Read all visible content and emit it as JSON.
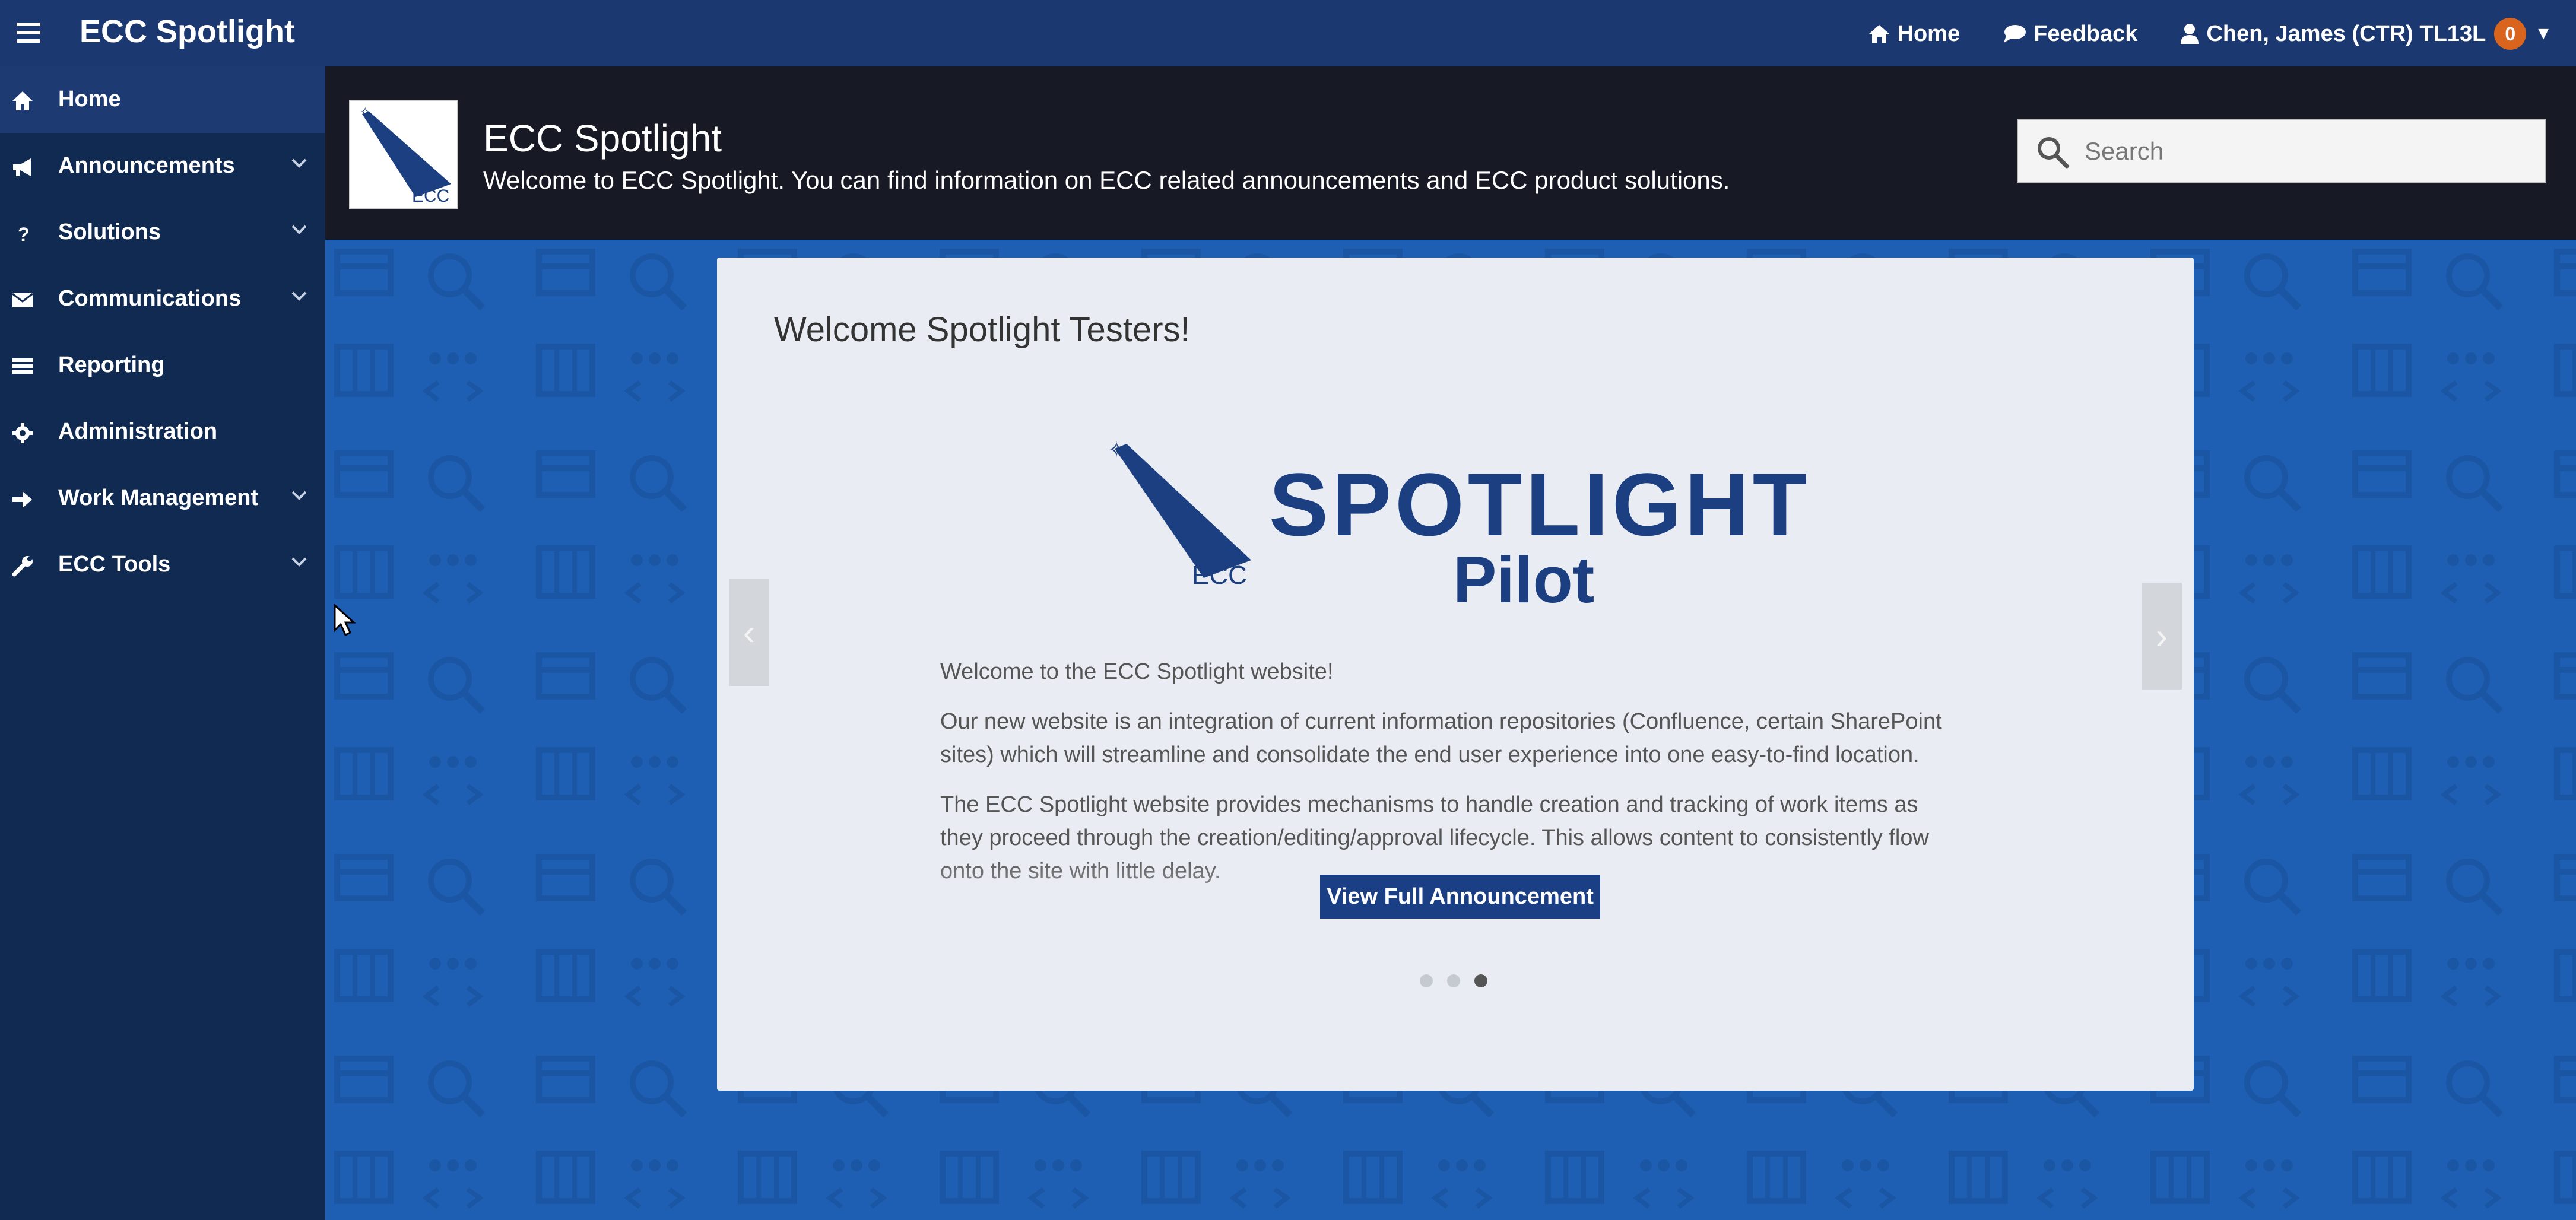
{
  "app": {
    "brand": "ECC Spotlight"
  },
  "topnav": {
    "home_label": "Home",
    "feedback_label": "Feedback",
    "user_label": "Chen, James (CTR) TL13L",
    "notification_count": "0"
  },
  "sidebar": {
    "items": [
      {
        "label": "Home",
        "icon": "home-icon",
        "active": true,
        "has_submenu": false
      },
      {
        "label": "Announcements",
        "icon": "megaphone-icon",
        "active": false,
        "has_submenu": true
      },
      {
        "label": "Solutions",
        "icon": "question-icon",
        "active": false,
        "has_submenu": true
      },
      {
        "label": "Communications",
        "icon": "envelope-icon",
        "active": false,
        "has_submenu": true
      },
      {
        "label": "Reporting",
        "icon": "report-icon",
        "active": false,
        "has_submenu": false
      },
      {
        "label": "Administration",
        "icon": "gear-icon",
        "active": false,
        "has_submenu": false
      },
      {
        "label": "Work Management",
        "icon": "arrow-right-icon",
        "active": false,
        "has_submenu": true
      },
      {
        "label": "ECC Tools",
        "icon": "wrench-icon",
        "active": false,
        "has_submenu": true
      }
    ]
  },
  "header": {
    "logo_text": "ECC",
    "title": "ECC Spotlight",
    "subtitle": "Welcome to ECC Spotlight. You can find information on ECC related announcements and ECC product solutions.",
    "search_placeholder": "Search"
  },
  "announcement": {
    "title": "Welcome Spotlight Testers!",
    "logo_line1": "SPOTLIGHT",
    "logo_line2": "Pilot",
    "logo_badge": "ECC",
    "paragraphs": [
      "Welcome to the ECC Spotlight website!",
      "Our new website is an integration of current information repositories (Confluence, certain SharePoint sites) which will streamline and consolidate the end user experience into one easy-to-find location.",
      "The ECC Spotlight website provides mechanisms to handle creation and tracking of work items as they proceed through the creation/editing/approval lifecycle. This allows content to consistently flow onto the site with little delay."
    ],
    "button_label": "View Full Announcement",
    "slides_total": 3,
    "active_slide": 3,
    "prev_glyph": "‹",
    "next_glyph": "›"
  },
  "colors": {
    "topbar": "#1c3870",
    "sidebar": "#102a52",
    "header": "#171a25",
    "main_bg": "#1f5fb3",
    "brand_blue": "#1c3f82",
    "badge": "#d8641e"
  }
}
